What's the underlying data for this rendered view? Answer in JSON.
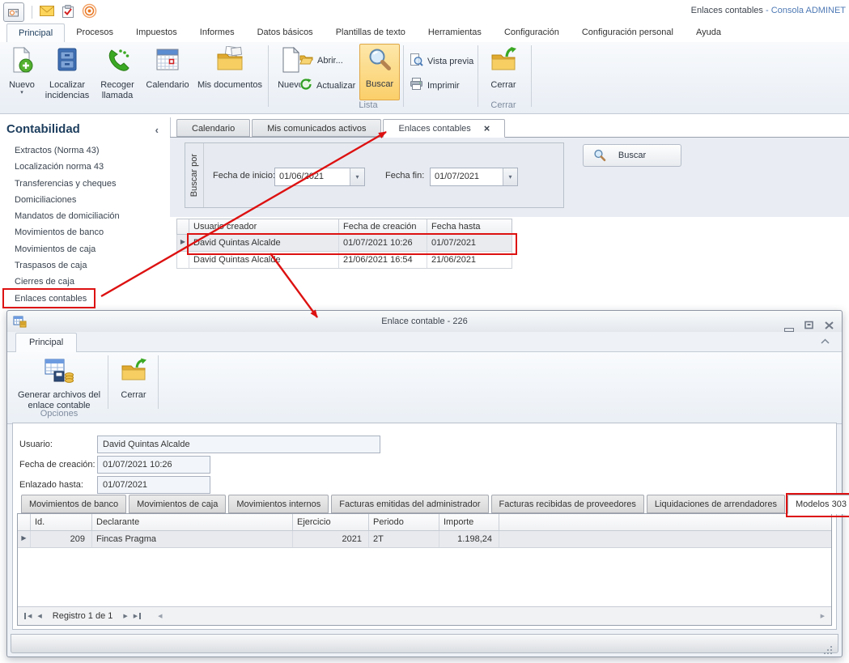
{
  "colors": {
    "annotation": "#dd1111",
    "search_highlight": "#fbcf6a",
    "title_blue": "#4f7ab5"
  },
  "icons": {
    "close_tab": "×",
    "dropdown": "▾",
    "collapse_left": "‹",
    "row_indicator": "▶",
    "pg_first": "◀",
    "pg_prev": "◀",
    "pg_next": "▶",
    "pg_last": "▶",
    "scroll_left": "◀",
    "scroll_right": "▶"
  },
  "window": {
    "title_left": "Enlaces contables",
    "title_right": "- Consola ADMINET"
  },
  "ribbon": {
    "tabs": [
      "Principal",
      "Procesos",
      "Impuestos",
      "Informes",
      "Datos básicos",
      "Plantillas de texto",
      "Herramientas",
      "Configuración",
      "Configuración personal",
      "Ayuda"
    ],
    "active_tab": "Principal",
    "buttons": {
      "nuevo": "Nuevo",
      "localizar": "Localizar incidencias",
      "recoger": "Recoger llamada",
      "calendario": "Calendario",
      "mis_documentos": "Mis documentos",
      "nuevo2": "Nuevo",
      "abrir": "Abrir...",
      "actualizar": "Actualizar",
      "buscar": "Buscar",
      "vista_previa": "Vista previa",
      "imprimir": "Imprimir",
      "cerrar": "Cerrar"
    },
    "group_labels": {
      "lista": "Lista",
      "cerrar": "Cerrar"
    }
  },
  "sidebar": {
    "title": "Contabilidad",
    "items": [
      "Extractos (Norma 43)",
      "Localización norma 43",
      "Transferencias y cheques",
      "Domiciliaciones",
      "Mandatos de domiciliación",
      "Movimientos de banco",
      "Movimientos de caja",
      "Traspasos de caja",
      "Cierres de caja",
      "Enlaces contables"
    ],
    "active_item": "Enlaces contables"
  },
  "main": {
    "tabs": [
      "Calendario",
      "Mis comunicados activos",
      "Enlaces contables"
    ],
    "active_tab": "Enlaces contables",
    "filter": {
      "group_label": "Buscar por",
      "date_start_label": "Fecha de inicio:",
      "date_start_value": "01/06/2021",
      "date_end_label": "Fecha fin:",
      "date_end_value": "01/07/2021",
      "search_button": "Buscar"
    },
    "table": {
      "columns": [
        "Usuario creador",
        "Fecha de creación",
        "Fecha hasta"
      ],
      "rows": [
        [
          "David Quintas Alcalde",
          "01/07/2021 10:26",
          "01/07/2021"
        ],
        [
          "David Quintas Alcalde",
          "21/06/2021 16:54",
          "21/06/2021"
        ]
      ],
      "selected_row": 0
    }
  },
  "modal": {
    "title": "Enlace contable - 226",
    "tab": "Principal",
    "generar_button": "Generar archivos del enlace contable",
    "cerrar_button": "Cerrar",
    "group_label": "Opciones",
    "form": {
      "usuario_label": "Usuario:",
      "usuario_value": "David Quintas Alcalde",
      "creacion_label": "Fecha de creación:",
      "creacion_value": "01/07/2021 10:26",
      "enlazado_label": "Enlazado hasta:",
      "enlazado_value": "01/07/2021"
    },
    "tabs": [
      "Movimientos de banco",
      "Movimientos de caja",
      "Movimientos internos",
      "Facturas emitidas del administrador",
      "Facturas recibidas de proveedores",
      "Liquidaciones de arrendadores",
      "Modelos 303"
    ],
    "active_tab": "Modelos 303",
    "table": {
      "columns": [
        "Id.",
        "Declarante",
        "Ejercicio",
        "Periodo",
        "Importe"
      ],
      "rows": [
        [
          "209",
          "Fincas Pragma",
          "2021",
          "2T",
          "1.198,24"
        ]
      ]
    },
    "pagination": "Registro 1 de 1"
  }
}
